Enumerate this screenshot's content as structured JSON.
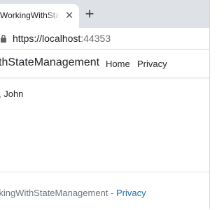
{
  "browser": {
    "tab_title": "WorkingWithStateM",
    "close_glyph": "✕",
    "new_tab_glyph": "+",
    "url": "https://localhost",
    "url_port": ":44353"
  },
  "navbar": {
    "brand": "thStateManagement",
    "links": [
      "Home",
      "Privacy"
    ]
  },
  "main": {
    "greeting": ", John"
  },
  "footer": {
    "text": "rkingWithStateManagement - ",
    "link": "Privacy"
  }
}
